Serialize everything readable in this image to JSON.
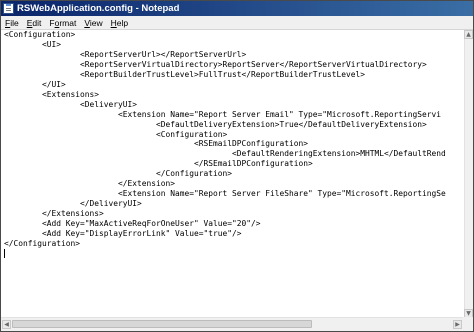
{
  "window": {
    "title": "RSWebApplication.config - Notepad",
    "app_icon": "notepad-icon"
  },
  "menu": {
    "items": [
      {
        "accel": "F",
        "rest": "ile"
      },
      {
        "accel": "E",
        "rest": "dit"
      },
      {
        "accel": "",
        "rest": "F",
        "accel2": "o",
        "rest2": "rmat"
      },
      {
        "accel": "V",
        "rest": "iew"
      },
      {
        "accel": "H",
        "rest": "elp"
      }
    ]
  },
  "editor": {
    "lines": [
      "<Configuration>",
      "        <UI>",
      "                <ReportServerUrl></ReportServerUrl>",
      "                <ReportServerVirtualDirectory>ReportServer</ReportServerVirtualDirectory>",
      "                <ReportBuilderTrustLevel>FullTrust</ReportBuilderTrustLevel>",
      "        </UI>",
      "        <Extensions>",
      "                <DeliveryUI>",
      "                        <Extension Name=\"Report Server Email\" Type=\"Microsoft.ReportingServi",
      "                                <DefaultDeliveryExtension>True</DefaultDeliveryExtension>",
      "                                <Configuration>",
      "                                        <RSEmailDPConfiguration>",
      "                                                <DefaultRenderingExtension>MHTML</DefaultRend",
      "                                        </RSEmailDPConfiguration>",
      "                                </Configuration>",
      "                        </Extension>",
      "                        <Extension Name=\"Report Server FileShare\" Type=\"Microsoft.ReportingSe",
      "                </DeliveryUI>",
      "        </Extensions>",
      "        <Add Key=\"MaxActiveReqForOneUser\" Value=\"20\"/>",
      "        <Add Key=\"DisplayErrorLink\" Value=\"true\"/>",
      "</Configuration>"
    ]
  },
  "icons": {
    "scroll_up": "scroll-up-arrow-icon",
    "scroll_down": "scroll-down-arrow-icon",
    "scroll_left": "scroll-left-arrow-icon",
    "scroll_right": "scroll-right-arrow-icon"
  }
}
